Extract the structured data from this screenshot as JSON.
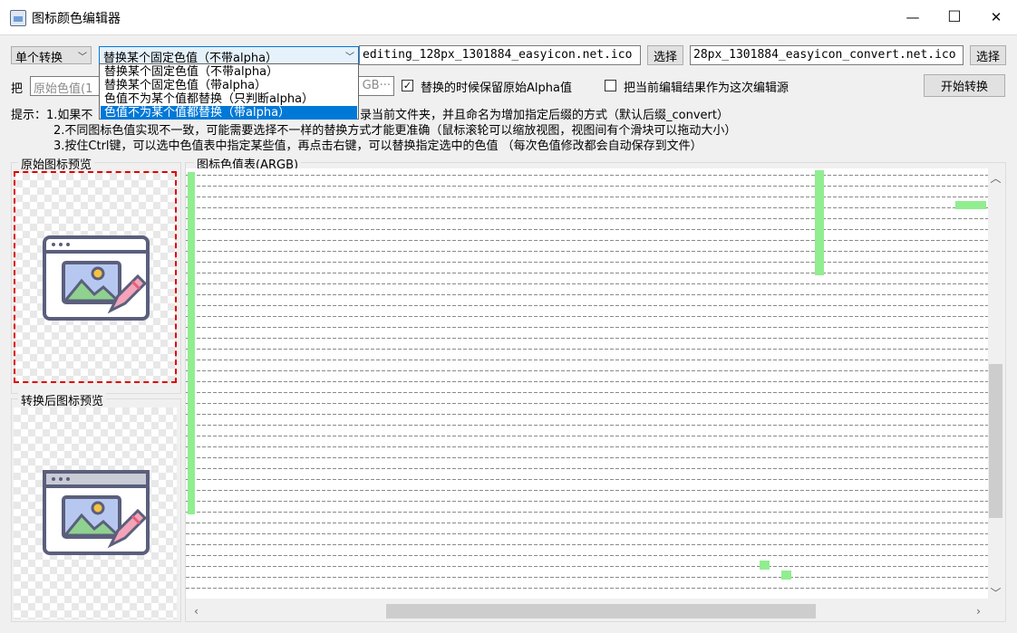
{
  "window": {
    "title": "图标颜色编辑器",
    "minimize_glyph": "—",
    "maximize_glyph": "☐",
    "close_glyph": "✕"
  },
  "toolbar": {
    "mode_combo": "单个转换",
    "replace_combo": "替换某个固定色值（不带alpha）",
    "source_path": "editing_128px_1301884_easyicon.net.ico",
    "select_label": "选择",
    "dest_path": "28px_1301884_easyicon_convert.net.ico",
    "select2_label": "选择"
  },
  "replace_options": [
    "替换某个固定色值（不带alpha）",
    "替换某个固定色值（带alpha）",
    "色值不为某个值都替换（只判断alpha）",
    "色值不为某个值都替换（带alpha）"
  ],
  "row2": {
    "prefix": "把",
    "source_color_placeholder": "原始色值(1",
    "target_color_partial": "GB···",
    "keep_alpha_label": "替换的时候保留原始Alpha值",
    "keep_alpha_checked": true,
    "use_as_source_label": "把当前编辑结果作为这次编辑源",
    "use_as_source_checked": false,
    "start_label": "开始转换"
  },
  "hints": {
    "line1_prefix": "提示：1.如果不",
    "line1_suffix": "录当前文件夹，并且命名为增加指定后缀的方式（默认后缀_convert）",
    "line2": "2.不同图标色值实现不一致，可能需要选择不一样的替换方式才能更准确（鼠标滚轮可以缩放视图，视图间有个滑块可以拖动大小）",
    "line3": "3.按住Ctrl键，可以选中色值表中指定某些值，再点击右键，可以替换指定选中的色值 （每次色值修改都会自动保存到文件）"
  },
  "panels": {
    "original_preview": "原始图标预览",
    "converted_preview": "转换后图标预览",
    "color_table": "图标色值表(ARGB)"
  },
  "colors": {
    "highlight": "#90ee90",
    "selection": "#0078d7",
    "preview_border": "#e00000",
    "icon_stroke": "#5b5f7c"
  },
  "icons": {
    "app": "image-editor-icon",
    "preview": "image-edit-icon"
  }
}
